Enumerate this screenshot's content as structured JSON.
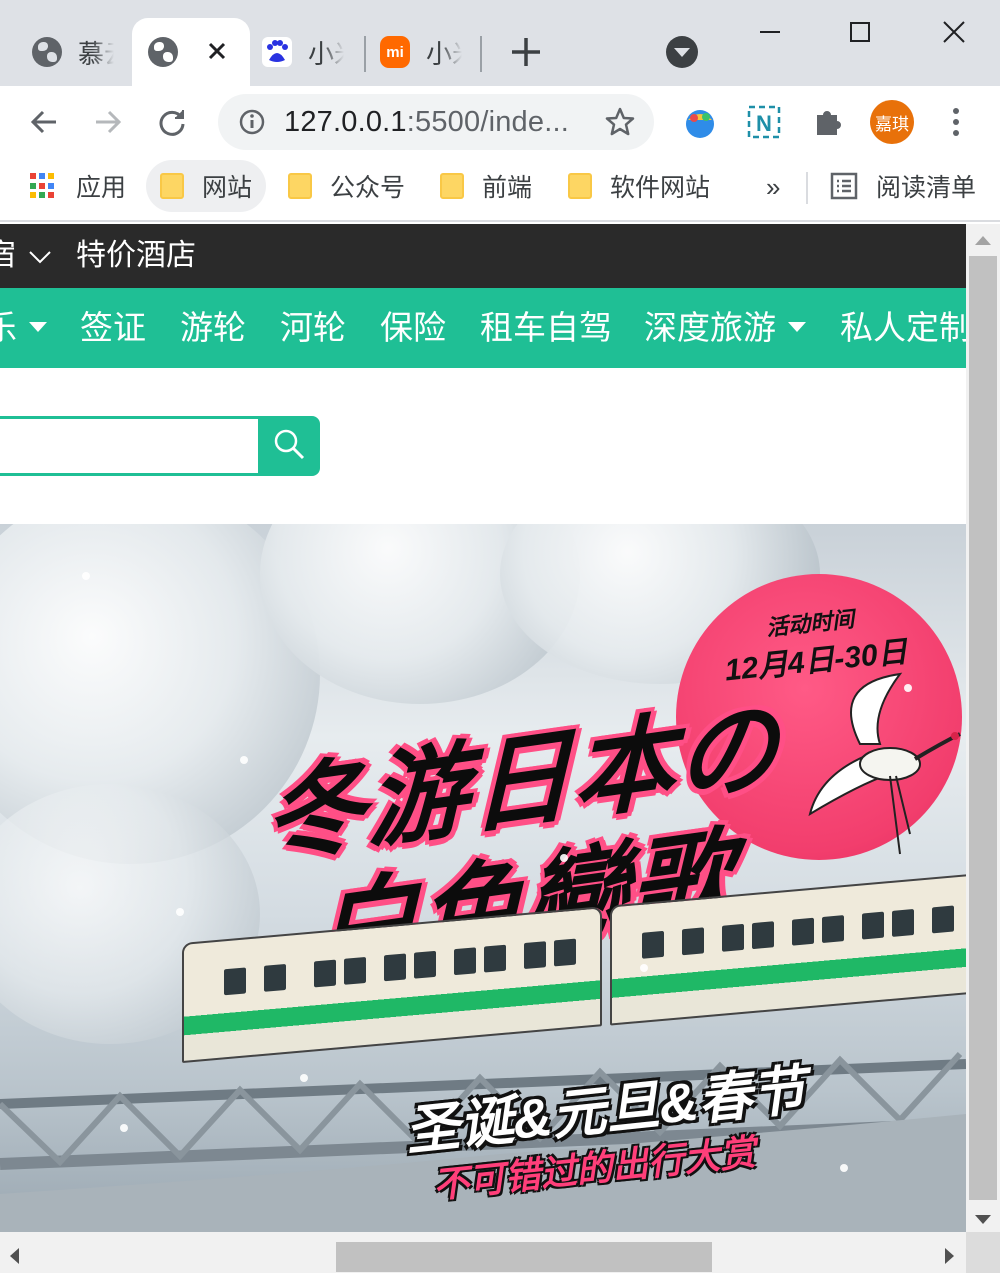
{
  "browser": {
    "tabs": [
      {
        "title": "慕云",
        "icon": "globe-icon",
        "active": false
      },
      {
        "title": "",
        "icon": "globe-icon",
        "active": true
      },
      {
        "title": "小米",
        "icon": "baidu-icon",
        "active": false
      },
      {
        "title": "小米",
        "icon": "mi-icon",
        "icon_text": "mi",
        "active": false
      }
    ],
    "url": {
      "host": "127.0.0.1",
      "rest": ":5500/inde..."
    },
    "profile_label": "嘉琪",
    "accent_profile": "#e8710a"
  },
  "bookmarks": [
    {
      "label": "应用",
      "icon": "apps-grid-icon"
    },
    {
      "label": "网站",
      "icon": "folder-icon"
    },
    {
      "label": "公众号",
      "icon": "folder-icon"
    },
    {
      "label": "前端",
      "icon": "folder-icon"
    },
    {
      "label": "软件网站",
      "icon": "folder-icon"
    }
  ],
  "bookmarks_more": "»",
  "reading_list": "阅读清单",
  "site": {
    "topbar": {
      "partial_item": "宿",
      "item": "特价酒店"
    },
    "nav": [
      {
        "label": "乐",
        "dropdown": true
      },
      {
        "label": "签证",
        "dropdown": false
      },
      {
        "label": "游轮",
        "dropdown": false
      },
      {
        "label": "河轮",
        "dropdown": false
      },
      {
        "label": "保险",
        "dropdown": false
      },
      {
        "label": "租车自驾",
        "dropdown": false
      },
      {
        "label": "深度旅游",
        "dropdown": true
      },
      {
        "label": "私人定制",
        "dropdown": false
      }
    ],
    "accent": "#1fbf95",
    "search": {
      "placeholder": ""
    },
    "banner": {
      "activity_label": "活动时间",
      "activity_date": "12月4日-30日",
      "title_line1": "冬游日本の",
      "title_line2": "白色戀歌",
      "slogan": "圣诞&元旦&春节",
      "subslogan": "不可错过的出行大赏"
    }
  }
}
